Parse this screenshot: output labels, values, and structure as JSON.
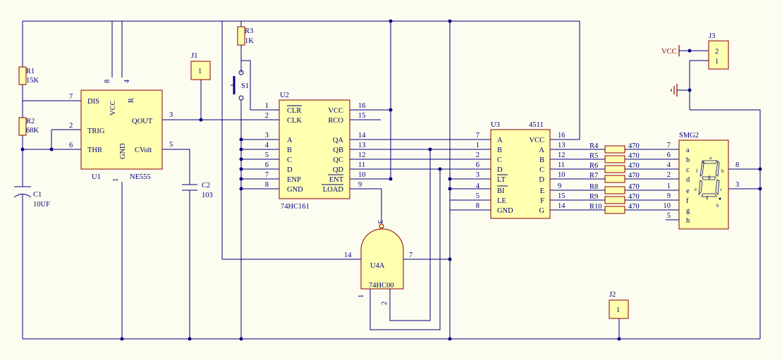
{
  "u1": {
    "ref": "U1",
    "part": "NE555",
    "pins_left": [
      {
        "num": "7",
        "name": "DIS"
      },
      {
        "num": "2",
        "name": "TRIG"
      },
      {
        "num": "6",
        "name": "THR"
      }
    ],
    "pins_top": [
      {
        "num": "8",
        "name": "VCC"
      },
      {
        "num": "4",
        "name": "R"
      }
    ],
    "pin_bottom": {
      "num": "1",
      "name": "GND"
    },
    "pins_right": [
      {
        "num": "3",
        "name": "QOUT"
      },
      {
        "num": "5",
        "name": "CVolt"
      }
    ]
  },
  "u2": {
    "ref": "U2",
    "part": "74HC161",
    "pins_left": [
      {
        "num": "1",
        "name": "CLR"
      },
      {
        "num": "2",
        "name": "CLK"
      },
      {
        "num": "3",
        "name": "A"
      },
      {
        "num": "4",
        "name": "B"
      },
      {
        "num": "5",
        "name": "C"
      },
      {
        "num": "6",
        "name": "D"
      },
      {
        "num": "7",
        "name": "ENP"
      },
      {
        "num": "8",
        "name": "GND"
      }
    ],
    "pins_right": [
      {
        "num": "16",
        "name": "VCC"
      },
      {
        "num": "15",
        "name": "RCO"
      },
      {
        "num": "14",
        "name": "QA"
      },
      {
        "num": "13",
        "name": "QB"
      },
      {
        "num": "12",
        "name": "QC"
      },
      {
        "num": "11",
        "name": "QD"
      },
      {
        "num": "10",
        "name": "ENT"
      },
      {
        "num": "9",
        "name": "LOAD"
      }
    ]
  },
  "u3": {
    "ref": "U3",
    "part": "4511",
    "pins_left": [
      {
        "num": "7",
        "name": "A"
      },
      {
        "num": "1",
        "name": "B"
      },
      {
        "num": "2",
        "name": "C"
      },
      {
        "num": "6",
        "name": "D"
      },
      {
        "num": "3",
        "name": "LT"
      },
      {
        "num": "4",
        "name": "BI"
      },
      {
        "num": "5",
        "name": "LE"
      },
      {
        "num": "8",
        "name": "GND"
      }
    ],
    "pins_right": [
      {
        "num": "16",
        "name": "VCC"
      },
      {
        "num": "13",
        "name": "A"
      },
      {
        "num": "12",
        "name": "B"
      },
      {
        "num": "11",
        "name": "C"
      },
      {
        "num": "10",
        "name": "D"
      },
      {
        "num": "9",
        "name": "E"
      },
      {
        "num": "15",
        "name": "F"
      },
      {
        "num": "14",
        "name": "G"
      }
    ]
  },
  "u4": {
    "ref": "U4A",
    "part": "74HC00",
    "pin_out": "7",
    "pin_in1": "14",
    "pin_top": "3",
    "pin_b1": "1",
    "pin_b2": "2"
  },
  "resistors": [
    {
      "ref": "R1",
      "value": "15K"
    },
    {
      "ref": "R2",
      "value": "68K"
    },
    {
      "ref": "R3",
      "value": "1K"
    }
  ],
  "seg_resistors": [
    {
      "ref": "R4",
      "value": "470"
    },
    {
      "ref": "R5",
      "value": "470"
    },
    {
      "ref": "R6",
      "value": "470"
    },
    {
      "ref": "R7",
      "value": "470"
    },
    {
      "ref": "R8",
      "value": "470"
    },
    {
      "ref": "R9",
      "value": "470"
    },
    {
      "ref": "R10",
      "value": "470"
    }
  ],
  "caps": [
    {
      "ref": "C1",
      "value": "10UF"
    },
    {
      "ref": "C2",
      "value": "103"
    }
  ],
  "switch": {
    "ref": "S1"
  },
  "jumpers": [
    {
      "ref": "J1",
      "pin": "1"
    },
    {
      "ref": "J2",
      "pin": "1"
    }
  ],
  "j3": {
    "ref": "J3",
    "pins": [
      "2",
      "1"
    ],
    "vcc_label": "VCC"
  },
  "display": {
    "ref": "SMG2",
    "pins": [
      {
        "num": "7",
        "name": "a"
      },
      {
        "num": "6",
        "name": "b"
      },
      {
        "num": "4",
        "name": "c"
      },
      {
        "num": "2",
        "name": "d"
      },
      {
        "num": "1",
        "name": "e"
      },
      {
        "num": "9",
        "name": "f"
      },
      {
        "num": "10",
        "name": "g"
      },
      {
        "num": "5",
        "name": "h"
      }
    ],
    "common_pins": [
      "8",
      "3"
    ],
    "seg_letters": [
      "a",
      "b",
      "c",
      "d",
      "e",
      "f",
      "g",
      "h"
    ]
  },
  "colors": {
    "wire": "#000080",
    "body_fill": "#ffffb0",
    "body_stroke": "#8b0000",
    "background": "#fcfcf0"
  }
}
